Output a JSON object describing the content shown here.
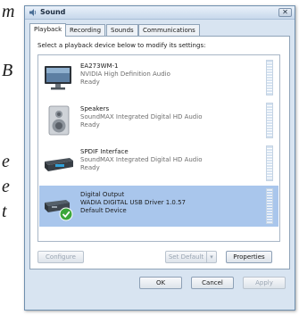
{
  "background_fragments": [
    "m",
    "B",
    "e",
    "e",
    "t"
  ],
  "window": {
    "title": "Sound",
    "close_glyph": "✕"
  },
  "tabs": [
    {
      "label": "Playback",
      "active": true
    },
    {
      "label": "Recording",
      "active": false
    },
    {
      "label": "Sounds",
      "active": false
    },
    {
      "label": "Communications",
      "active": false
    }
  ],
  "instruction": "Select a playback device below to modify its settings:",
  "devices": [
    {
      "name": "EA273WM-1",
      "driver": "NVIDIA High Definition Audio",
      "status": "Ready",
      "icon": "monitor-icon",
      "selected": false
    },
    {
      "name": "Speakers",
      "driver": "SoundMAX Integrated Digital HD Audio",
      "status": "Ready",
      "icon": "speaker-icon",
      "selected": false
    },
    {
      "name": "SPDIF Interface",
      "driver": "SoundMAX Integrated Digital HD Audio",
      "status": "Ready",
      "icon": "spdif-device-icon",
      "selected": false
    },
    {
      "name": "Digital Output",
      "driver": "WADIA DIGITAL USB Driver 1.0.57",
      "status": "Default Device",
      "icon": "usb-dac-icon",
      "selected": true
    }
  ],
  "buttons": {
    "configure": "Configure",
    "set_default": "Set Default",
    "set_default_arrow": "▾",
    "properties": "Properties",
    "ok": "OK",
    "cancel": "Cancel",
    "apply": "Apply"
  },
  "colors": {
    "selection": "#a9c6ec",
    "default_check": "#3aa63a"
  }
}
